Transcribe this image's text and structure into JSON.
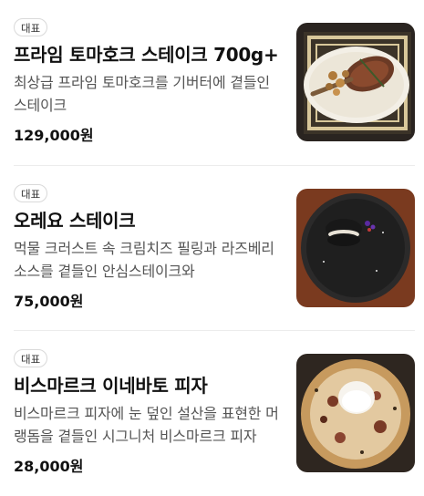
{
  "menu_items": [
    {
      "badge": "대표",
      "name": "프라임 토마호크 스테이크 700g+",
      "description": "최상급 프라임 토마호크를 기버터에 곁들인 스테이크",
      "price": "129,000원",
      "image_icon": "steak-photo"
    },
    {
      "badge": "대표",
      "name": "오레요 스테이크",
      "description": "먹물 크러스트 속 크림치즈 필링과 라즈베리 소스를 곁들인 안심스테이크와",
      "price": "75,000원",
      "image_icon": "oreo-steak-photo"
    },
    {
      "badge": "대표",
      "name": "비스마르크 이네바토 피자",
      "description": "비스마르크 피자에 눈 덮인 설산을 표현한 머랭돔을 곁들인 시그니처 비스마르크 피자",
      "price": "28,000원",
      "image_icon": "pizza-photo"
    }
  ]
}
